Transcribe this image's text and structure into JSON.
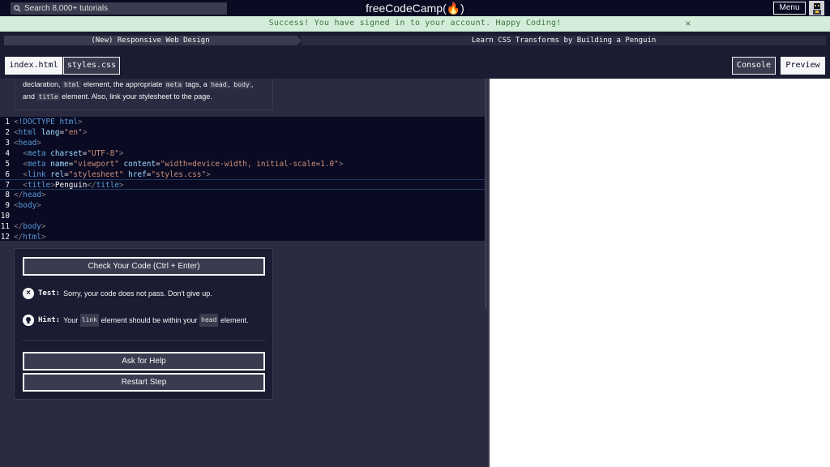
{
  "nav": {
    "search_placeholder": "Search 8,000+ tutorials",
    "logo_text": "freeCodeCamp(🔥)",
    "menu_label": "Menu"
  },
  "flash": {
    "message": "Success! You have signed in to your account. Happy Coding!",
    "close_symbol": "×"
  },
  "breadcrumb": {
    "course": "(New) Responsive Web Design",
    "project": "Learn CSS Transforms by Building a Penguin"
  },
  "toolbar": {
    "tabs": [
      "index.html",
      "styles.css"
    ],
    "console_label": "Console",
    "preview_label": "Preview"
  },
  "description": {
    "l1_a": "declaration,",
    "l1_code1": "html",
    "l1_b": "element, the appropriate",
    "l1_code2": "meta",
    "l1_c": "tags, a",
    "l1_code3": "head",
    "l1_d": ",",
    "l1_code4": "body",
    "l1_e": ",",
    "l2_a": "and",
    "l2_code1": "title",
    "l2_b": "element. Also, link your stylesheet to the page."
  },
  "editor": {
    "line_numbers": [
      "1",
      "2",
      "3",
      "4",
      "5",
      "6",
      "7",
      "8",
      "9",
      "10",
      "11",
      "12"
    ],
    "highlighted_line": 7
  },
  "panel": {
    "check_button": "Check Your Code (Ctrl + Enter)",
    "test_label": "Test:",
    "test_text": "Sorry, your code does not pass. Don't give up.",
    "test_icon": "×",
    "hint_label": "Hint:",
    "hint_a": "Your",
    "hint_code1": "link",
    "hint_b": "element should be within your",
    "hint_code2": "head",
    "hint_c": "element.",
    "hint_icon": "💡",
    "help_button": "Ask for Help",
    "restart_button": "Restart Step"
  }
}
